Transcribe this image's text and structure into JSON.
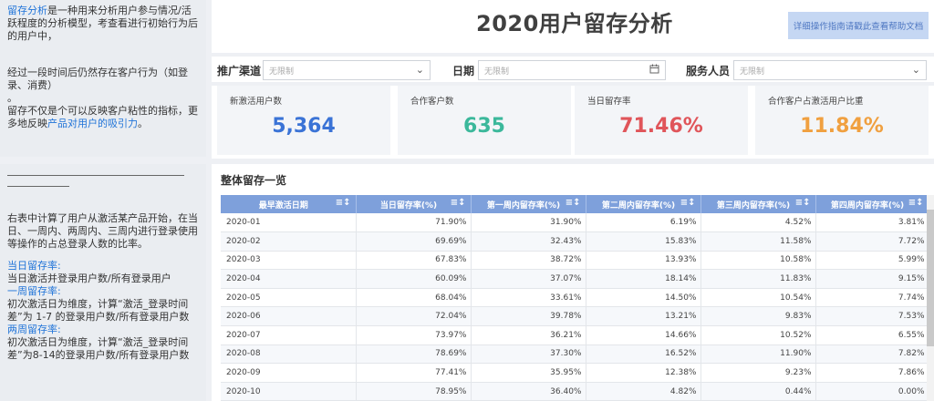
{
  "intro": {
    "term": "留存分析",
    "line1_rest": "是一种用来分析用户参与情况/活跃程度的分析模型，考查看进行初始行为后的用户中，",
    "line2": "经过一段时间后仍然存在客户行为（如登录、消费）",
    "dot": "。",
    "line3_start": "留存不仅是个可以反映客户粘性的指标，更多地反映",
    "line3_highlight": "产品对用户的吸引力",
    "line3_end": "。"
  },
  "explain": {
    "para": "右表中计算了用户从激活某产品开始，在当日、一周内、两周内、三周内进行登录使用等操作的占总登录人数的比率。",
    "items": [
      {
        "label": "当日留存率:",
        "text": "当日激活并登录用户数/所有登录用户"
      },
      {
        "label": "一周留存率:",
        "text": "初次激活日为维度，计算“激活_登录时间差”为 1-7 的登录用户数/所有登录用户数"
      },
      {
        "label": "两周留存率:",
        "text": "初次激活日为维度，计算“激活_登录时间差”为8-14的登录用户数/所有登录用户数"
      }
    ]
  },
  "header": {
    "title": "2020用户留存分析",
    "help_button": "详细操作指南请戳此查看帮助文档"
  },
  "filters": {
    "channel_label": "推广渠道",
    "channel_placeholder": "无限制",
    "date_label": "日期",
    "date_placeholder": "无限制",
    "staff_label": "服务人员",
    "staff_placeholder": "无限制"
  },
  "kpis": [
    {
      "title": "新激活用户数",
      "value": "5,364",
      "color": "#3a73d6"
    },
    {
      "title": "合作客户数",
      "value": "635",
      "color": "#3bb89b"
    },
    {
      "title": "当日留存率",
      "value": "71.46%",
      "color": "#e0555a"
    },
    {
      "title": "合作客户占激活用户比重",
      "value": "11.84%",
      "color": "#f0a040"
    }
  ],
  "table": {
    "title": "整体留存一览",
    "columns": [
      "最早激活日期",
      "当日留存率(%)",
      "第一周内留存率(%)",
      "第二周内留存率(%)",
      "第三周内留存率(%)",
      "第四周内留存率(%)"
    ],
    "rows": [
      [
        "2020-01",
        "71.90%",
        "31.90%",
        "6.19%",
        "4.52%",
        "3.81%"
      ],
      [
        "2020-02",
        "69.69%",
        "32.43%",
        "15.83%",
        "11.58%",
        "7.72%"
      ],
      [
        "2020-03",
        "67.83%",
        "38.72%",
        "13.93%",
        "10.58%",
        "5.99%"
      ],
      [
        "2020-04",
        "60.09%",
        "37.07%",
        "18.14%",
        "11.83%",
        "9.15%"
      ],
      [
        "2020-05",
        "68.04%",
        "33.61%",
        "14.50%",
        "10.54%",
        "7.74%"
      ],
      [
        "2020-06",
        "72.04%",
        "39.78%",
        "13.21%",
        "9.83%",
        "7.53%"
      ],
      [
        "2020-07",
        "73.97%",
        "36.21%",
        "14.66%",
        "10.52%",
        "6.55%"
      ],
      [
        "2020-08",
        "78.69%",
        "37.30%",
        "16.52%",
        "11.90%",
        "7.82%"
      ],
      [
        "2020-09",
        "77.41%",
        "35.95%",
        "12.38%",
        "9.23%",
        "7.86%"
      ],
      [
        "2020-10",
        "78.95%",
        "36.40%",
        "4.82%",
        "0.44%",
        "0.00%"
      ]
    ]
  }
}
